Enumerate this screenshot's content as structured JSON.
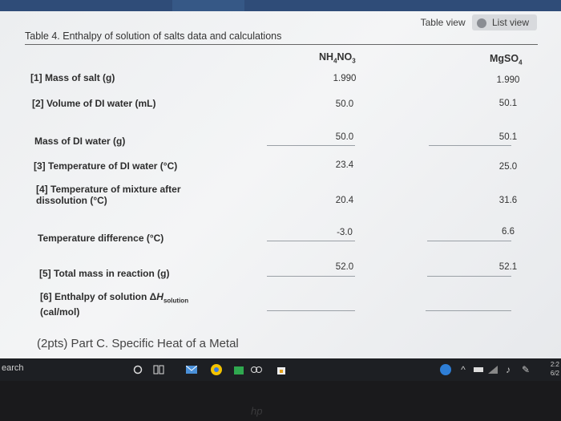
{
  "view_toggle": {
    "table_label": "Table view",
    "list_label": "List view"
  },
  "table": {
    "title": "Table 4. Enthalpy of solution of salts data and calculations",
    "columns": [
      {
        "name_main": "NH",
        "sub1": "4",
        "name_mid": "NO",
        "sub2": "3"
      },
      {
        "name_main": "MgSO",
        "sub1": "4",
        "name_mid": "",
        "sub2": ""
      }
    ],
    "rows": [
      {
        "label": "[1] Mass of salt (g)",
        "values": [
          "1.990",
          "1.990"
        ]
      },
      {
        "label": "[2] Volume of DI water (mL)",
        "values": [
          "50.0",
          "50.1"
        ]
      },
      {
        "label": "Mass of DI water (g)",
        "values": [
          "50.0",
          "50.1"
        ]
      },
      {
        "label": "[3] Temperature of DI water (°C)",
        "values": [
          "23.4",
          "25.0"
        ]
      },
      {
        "label_line1": "[4] Temperature of mixture after",
        "label_line2": "dissolution (°C)",
        "values": [
          "20.4",
          "31.6"
        ]
      },
      {
        "label": "Temperature difference (°C)",
        "values": [
          "-3.0",
          "6.6"
        ]
      },
      {
        "label": "[5] Total mass in reaction (g)",
        "values": [
          "52.0",
          "52.1"
        ]
      },
      {
        "label_line1_a": "[6] Enthalpy of solution Δ",
        "label_line1_h": "H",
        "label_line1_sub": "solution",
        "label_line2": "(cal/mol)",
        "values": [
          "",
          ""
        ]
      }
    ]
  },
  "section": {
    "heading": "(2pts) Part C. Specific Heat of a Metal"
  },
  "taskbar": {
    "search_text": "earch",
    "clock_time": "2:2",
    "clock_date": "6/2"
  },
  "brand": {
    "logo_text": "hp"
  }
}
